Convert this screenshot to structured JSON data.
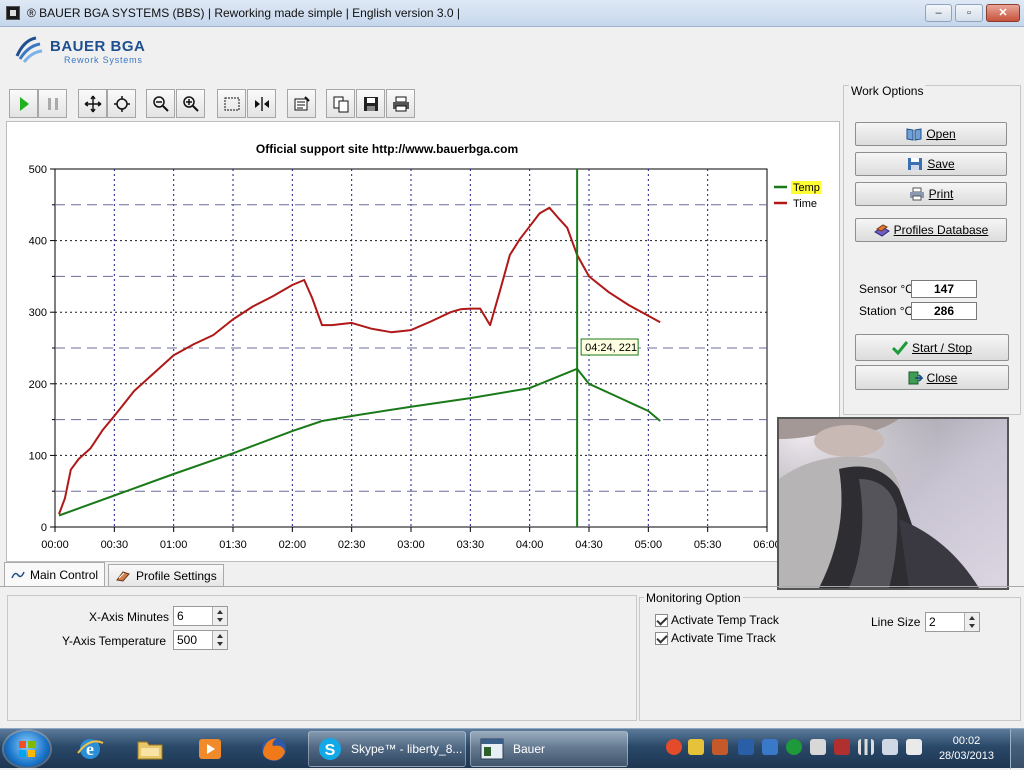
{
  "window": {
    "title": "® BAUER BGA SYSTEMS (BBS) | Reworking made simple | English version 3.0 |",
    "minimize": "–",
    "maximize": "▫",
    "close": "✕"
  },
  "logo": {
    "brand": "BAUER BGA",
    "sub": "Rework Systems"
  },
  "toolbar": {
    "buttons": [
      "play-icon",
      "pause-icon",
      "move-icon",
      "zoom-area-icon",
      "zoom-out-icon",
      "zoom-in-icon",
      "select-rect-icon",
      "fit-icon",
      "properties-icon",
      "copy-icon",
      "save-icon",
      "print-icon"
    ]
  },
  "work_options": {
    "legend": "Work Options",
    "open": "Open",
    "save": "Save",
    "print": "Print",
    "profiles": "Profiles Database",
    "sensor_label": "Sensor °C",
    "sensor_value": "147",
    "station_label": "Station °C",
    "station_value": "286",
    "start_stop": "Start / Stop",
    "close": "Close"
  },
  "chart_data": {
    "type": "line",
    "title": "Official support site http://www.bauerbga.com",
    "xlabel": "",
    "ylabel": "",
    "ylim": [
      0,
      500
    ],
    "xlim_minutes": [
      0,
      360
    ],
    "x_tick_labels": [
      "00:00",
      "00:30",
      "01:00",
      "01:30",
      "02:00",
      "02:30",
      "03:00",
      "03:30",
      "04:00",
      "04:30",
      "05:00",
      "05:30",
      "06:00"
    ],
    "y_tick_labels": [
      "0",
      "100",
      "200",
      "300",
      "400",
      "500"
    ],
    "grid": true,
    "legend_position": "top-right",
    "cursor": {
      "x_minutes": 264,
      "label": "04:24, 221"
    },
    "series": [
      {
        "name": "Temp",
        "color": "#1a7a1a",
        "x_minutes": [
          2,
          30,
          60,
          90,
          120,
          135,
          150,
          180,
          210,
          240,
          264,
          270,
          285,
          300,
          306
        ],
        "values": [
          16,
          44,
          74,
          103,
          134,
          148,
          155,
          168,
          180,
          194,
          221,
          200,
          181,
          162,
          148
        ]
      },
      {
        "name": "Time",
        "color": "#b01818",
        "x_minutes": [
          2,
          5,
          8,
          12,
          18,
          24,
          30,
          40,
          50,
          60,
          70,
          80,
          90,
          100,
          110,
          120,
          126,
          130,
          135,
          140,
          150,
          160,
          170,
          180,
          190,
          200,
          205,
          210,
          215,
          220,
          225,
          230,
          235,
          240,
          245,
          250,
          255,
          259,
          264,
          270,
          280,
          290,
          300,
          306
        ],
        "values": [
          18,
          40,
          80,
          95,
          110,
          135,
          155,
          190,
          215,
          240,
          255,
          268,
          290,
          308,
          322,
          338,
          345,
          320,
          282,
          282,
          285,
          277,
          272,
          275,
          287,
          300,
          304,
          305,
          305,
          282,
          330,
          380,
          402,
          420,
          438,
          446,
          430,
          418,
          380,
          350,
          328,
          310,
          295,
          286
        ]
      }
    ]
  },
  "webcam": {
    "kind": "live camera feed"
  },
  "tabs": [
    {
      "label": "Main Control",
      "active": true
    },
    {
      "label": "Profile Settings",
      "active": false
    }
  ],
  "main_control": {
    "x_axis_label": "X-Axis Minutes",
    "x_axis_value": "6",
    "y_axis_label": "Y-Axis Temperature",
    "y_axis_value": "500",
    "monitoring_legend": "Monitoring Option",
    "activate_temp": "Activate Temp Track",
    "activate_time": "Activate Time  Track",
    "line_size_label": "Line Size",
    "line_size_value": "2"
  },
  "taskbar": {
    "apps": [
      {
        "name": "skype",
        "label": "Skype™ - liberty_8..."
      },
      {
        "name": "bauer",
        "label": "Bauer"
      }
    ],
    "clock_time": "00:02",
    "clock_date": "28/03/2013"
  }
}
